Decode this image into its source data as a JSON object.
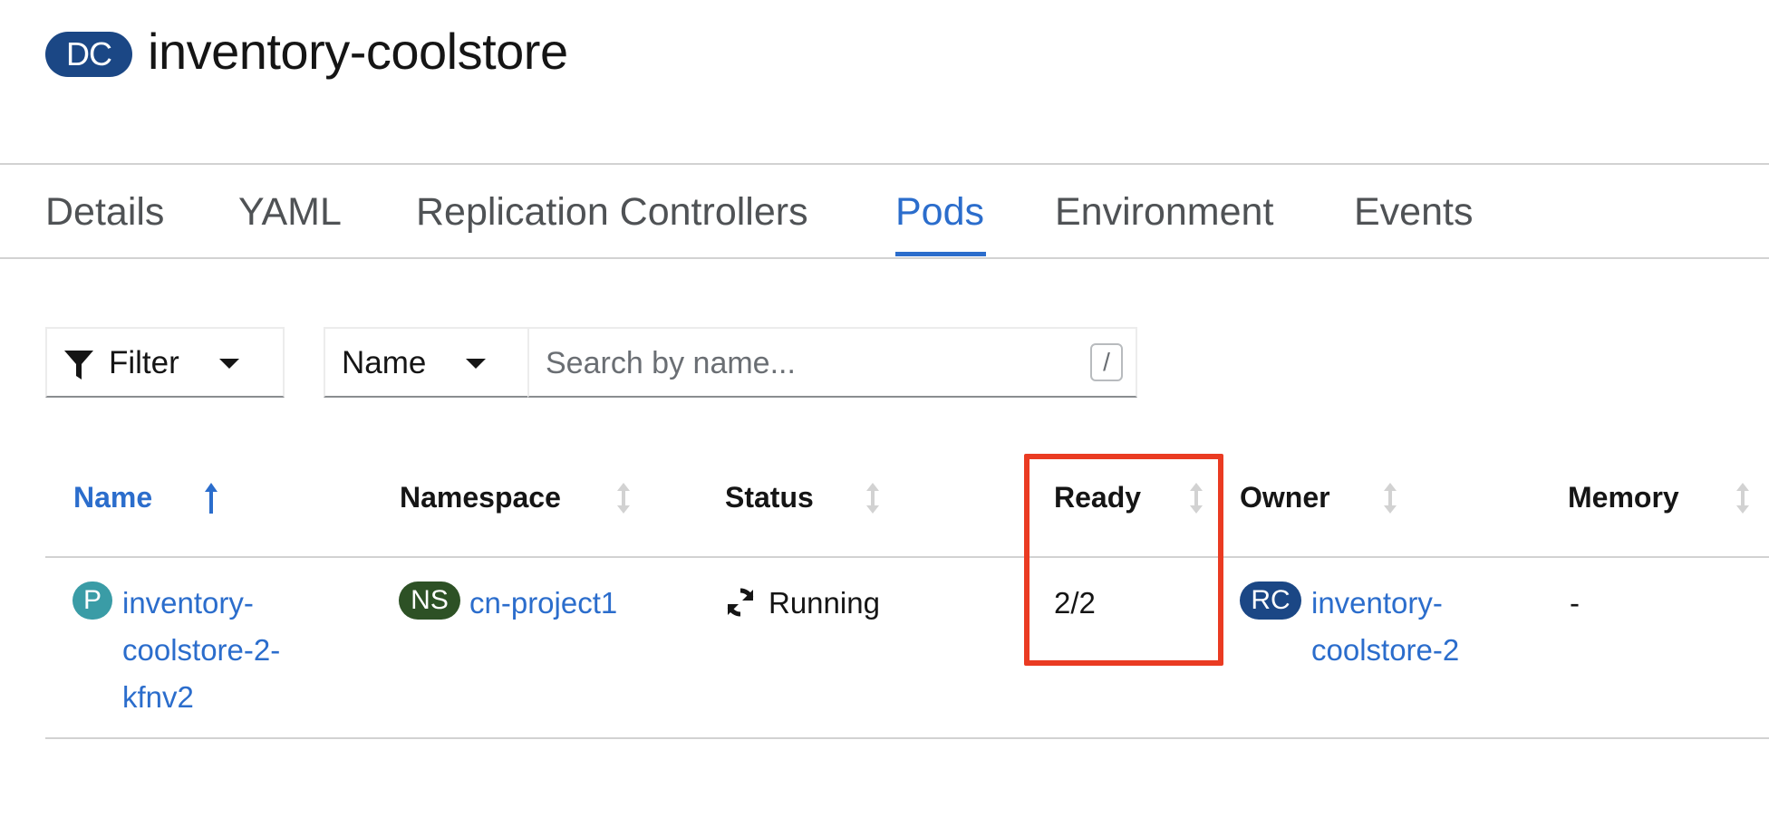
{
  "header": {
    "badge": "DC",
    "title": "inventory-coolstore"
  },
  "tabs": [
    {
      "label": "Details",
      "active": false
    },
    {
      "label": "YAML",
      "active": false
    },
    {
      "label": "Replication Controllers",
      "active": false
    },
    {
      "label": "Pods",
      "active": true
    },
    {
      "label": "Environment",
      "active": false
    },
    {
      "label": "Events",
      "active": false
    }
  ],
  "toolbar": {
    "filter_label": "Filter",
    "attribute_select": "Name",
    "search_placeholder": "Search by name...",
    "search_value": "",
    "shortcut_key": "/"
  },
  "table": {
    "columns": [
      {
        "label": "Name",
        "sort": "ascending"
      },
      {
        "label": "Namespace",
        "sort": "none"
      },
      {
        "label": "Status",
        "sort": "none"
      },
      {
        "label": "Ready",
        "sort": "none"
      },
      {
        "label": "Owner",
        "sort": "none"
      },
      {
        "label": "Memory",
        "sort": "none"
      }
    ],
    "rows": [
      {
        "name_badge": "P",
        "name": "inventory-coolstore-2-kfnv2",
        "name_lines": [
          "inventory-",
          "coolstore-2-",
          "kfnv2"
        ],
        "namespace_badge": "NS",
        "namespace": "cn-project1",
        "status": "Running",
        "status_icon": "sync-icon",
        "ready": "2/2",
        "owner_badge": "RC",
        "owner": "inventory-coolstore-2",
        "owner_lines": [
          "inventory-",
          "coolstore-2"
        ],
        "memory": "-"
      }
    ]
  },
  "annotation": {
    "highlighted_column": "Ready",
    "color": "#ea3b22"
  },
  "colors": {
    "accent": "#2b6dcc",
    "dc_badge": "#1b4785",
    "pod_badge": "#3a9ca6",
    "ns_badge": "#2d5125",
    "rc_badge": "#1b4785"
  }
}
